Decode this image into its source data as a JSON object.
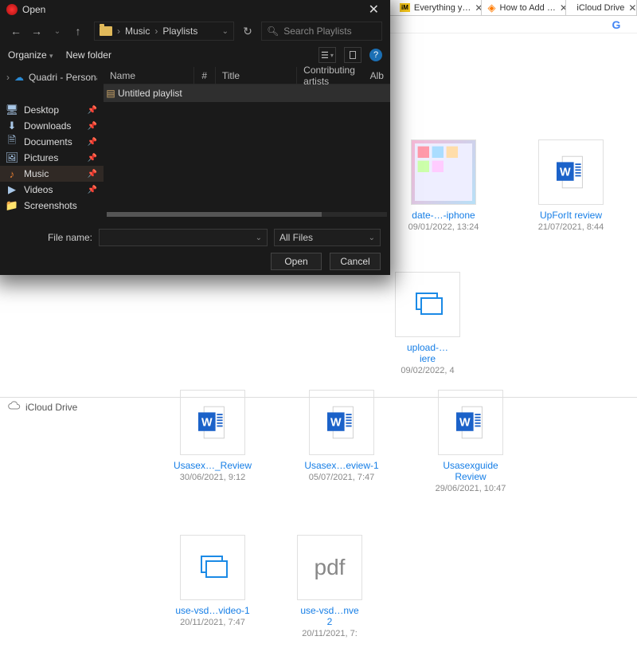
{
  "browser": {
    "tabs": [
      {
        "icon": "imdb",
        "label": "Everything y…",
        "active": false
      },
      {
        "icon": "wifi",
        "label": "How to Add …",
        "active": false
      },
      {
        "icon": "apple",
        "label": "iCloud Drive",
        "active": true
      }
    ],
    "google_glyph": "G"
  },
  "icloud": {
    "title": "iCloud Drive",
    "toolbar": [
      "cloud-download",
      "cloud-upload",
      "mail",
      "trash"
    ],
    "row1": [
      {
        "thumb": "photos",
        "name": "date-…-iphone",
        "date": "09/01/2022, 13:24"
      },
      {
        "thumb": "word",
        "name": "UpForIt review",
        "date": "21/07/2021, 8:44"
      },
      {
        "thumb": "stack",
        "name": "upload-…iere",
        "date": "09/02/2022, 4"
      }
    ],
    "row2": [
      {
        "thumb": "word",
        "name": "Usasex…_Review",
        "date": "30/06/2021, 9:12"
      },
      {
        "thumb": "word",
        "name": "Usasex…eview-1",
        "date": "05/07/2021, 7:47"
      },
      {
        "thumb": "word",
        "name": "Usasexguide Review",
        "date": "29/06/2021, 10:47"
      },
      {
        "thumb": "stack",
        "name": "use-vsd…video-1",
        "date": "20/11/2021, 7:47"
      },
      {
        "thumb": "pdf",
        "name": "use-vsd…nve 2",
        "date": "20/11/2021, 7:"
      }
    ],
    "footer_label": "iCloud Drive"
  },
  "dialog": {
    "title": "Open",
    "close": "✕",
    "nav": {
      "back": "←",
      "fwd": "→",
      "up": "↑",
      "reload": "↻"
    },
    "crumbs": [
      "Music",
      "Playlists"
    ],
    "search_placeholder": "Search Playlists",
    "toolbar": {
      "organize": "Organize",
      "new_folder": "New folder"
    },
    "columns": {
      "name": "Name",
      "num": "#",
      "title": "Title",
      "artists": "Contributing artists",
      "alb": "Alb"
    },
    "tree": {
      "root": "Quadri - Persona",
      "items": [
        {
          "icon": "desktop",
          "label": "Desktop"
        },
        {
          "icon": "download",
          "label": "Downloads"
        },
        {
          "icon": "doc",
          "label": "Documents"
        },
        {
          "icon": "picture",
          "label": "Pictures"
        },
        {
          "icon": "music",
          "label": "Music",
          "selected": true
        },
        {
          "icon": "video",
          "label": "Videos"
        },
        {
          "icon": "screen",
          "label": "Screenshots"
        }
      ]
    },
    "list_item": "Untitled playlist",
    "file_name_label": "File name:",
    "file_name_value": "",
    "filter": "All Files",
    "buttons": {
      "open": "Open",
      "cancel": "Cancel"
    }
  }
}
